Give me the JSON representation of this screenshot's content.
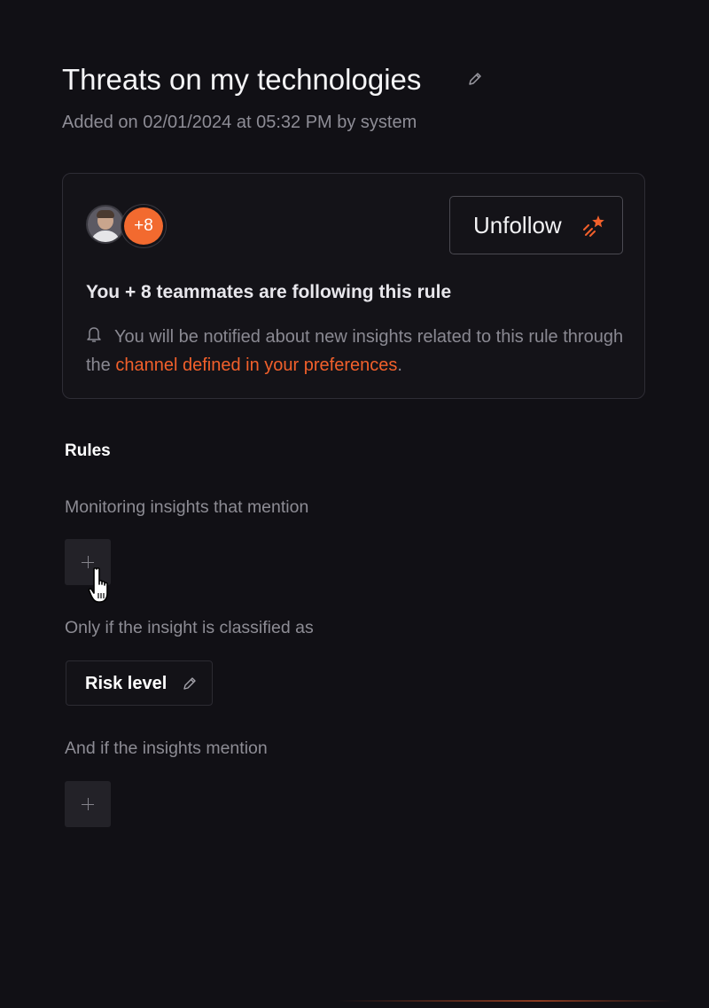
{
  "header": {
    "title": "Threats on my technologies",
    "subtitle": "Added on 02/01/2024 at 05:32 PM by system"
  },
  "follow_card": {
    "followers_badge": "+8",
    "unfollow_label": "Unfollow",
    "heading": "You + 8 teammates are following this rule",
    "notice_text": "You will be notified about new insights related to this rule through the ",
    "notice_link": "channel defined in your preferences",
    "notice_end": "."
  },
  "rules": {
    "title": "Rules",
    "monitoring_label": "Monitoring insights that mention",
    "classified_label": "Only if the insight is classified as",
    "risk_chip_label": "Risk level",
    "mention_label": "And if the insights mention"
  },
  "colors": {
    "background": "#111015",
    "accent": "#f2602b",
    "muted_text": "#8d8c94"
  },
  "icons": {
    "title_edit": "pencil-icon",
    "unfollow": "falling-star-icon",
    "notice": "bell-icon",
    "risk_edit": "pencil-icon",
    "add": "plus-icon",
    "pointer": "hand-cursor-icon"
  }
}
